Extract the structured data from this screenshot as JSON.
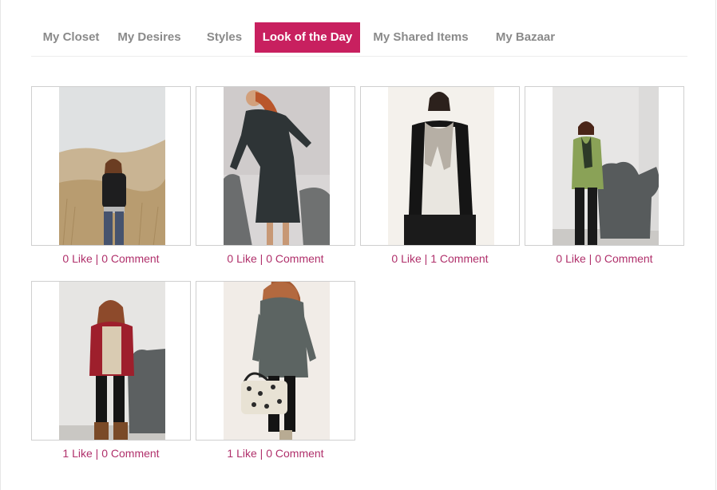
{
  "tabs": [
    {
      "label": "My Closet",
      "active": false
    },
    {
      "label": "My Desires",
      "active": false
    },
    {
      "label": "Styles",
      "active": false
    },
    {
      "label": "Look of the Day",
      "active": true
    },
    {
      "label": "My Shared Items",
      "active": false
    },
    {
      "label": "My Bazaar",
      "active": false
    }
  ],
  "looks": [
    {
      "likes": "0 Like",
      "comments": "0 Comment",
      "photo": "woman-field-black-jacket"
    },
    {
      "likes": "0 Like",
      "comments": "0 Comment",
      "photo": "woman-dark-dress-armchair"
    },
    {
      "likes": "0 Like",
      "comments": "1 Comment",
      "photo": "woman-lace-top-scarf"
    },
    {
      "likes": "0 Like",
      "comments": "0 Comment",
      "photo": "woman-green-sweater-armchair"
    },
    {
      "likes": "1 Like",
      "comments": "0 Comment",
      "photo": "woman-red-cardigan-armchair"
    },
    {
      "likes": "1 Like",
      "comments": "0 Comment",
      "photo": "woman-grey-sweater-dress-handbag"
    }
  ],
  "colors": {
    "accent": "#c8205f",
    "tab_text": "#8a8a8a",
    "stats_text": "#b0306b"
  }
}
